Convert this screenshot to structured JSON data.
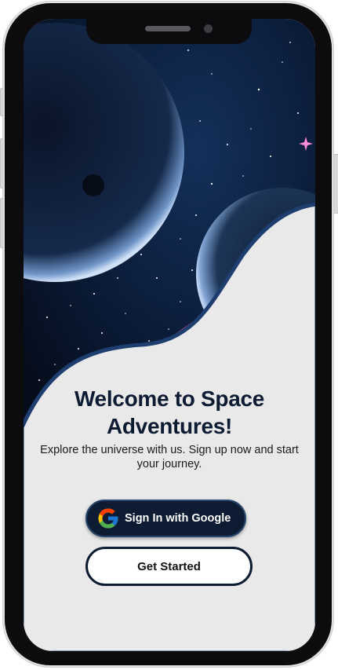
{
  "welcome": {
    "title_line1": "Welcome to Space",
    "title_line2": "Adventures!",
    "subtitle": "Explore the universe with us. Sign up now and start your journey."
  },
  "actions": {
    "google_label": "Sign In with Google",
    "start_label": "Get Started"
  },
  "icons": {
    "google": "google-g-icon",
    "camera": "front-camera",
    "speaker": "earpiece-speaker"
  },
  "colors": {
    "navy": "#0d1b33",
    "screen_bg": "#e9e9e9",
    "space_dark": "#06101e",
    "planet_glow": "#8fb5e8",
    "google_blue": "#4285F4",
    "google_red": "#EA4335",
    "google_yellow": "#FBBC05",
    "google_green": "#34A853"
  }
}
